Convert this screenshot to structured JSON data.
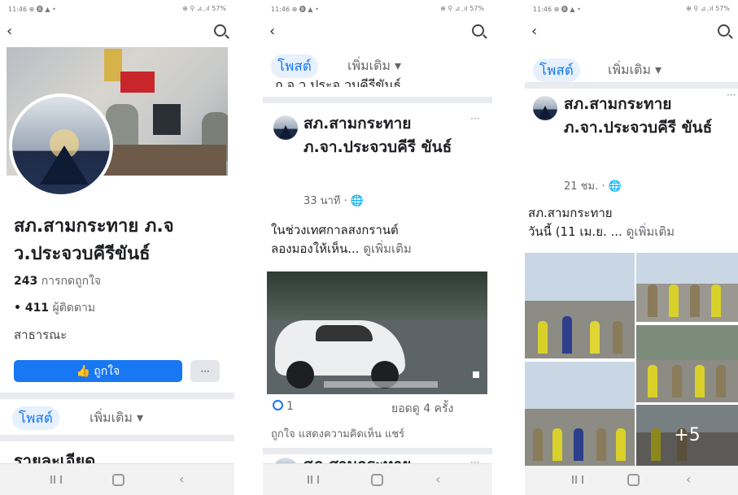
{
  "status_bar": {
    "time": "11:46 ⊕ 🅑 ▲ •",
    "right": "⊕ ⚲ ⊿ ᷊.ıl 57%"
  },
  "colors": {
    "accent": "#1877f2",
    "text": "#1c1e21",
    "muted": "#65676b"
  },
  "icons": {
    "back": "back-arrow-icon",
    "search": "search-icon"
  },
  "panel1": {
    "page_name": "สภ.สามกระทาย ภ.จ ว.ประจวบคีรีขันธ์",
    "likes_count": "243",
    "likes_label": "การกดถูกใจ",
    "followers_count": "411",
    "followers_label": "ผู้ติดตาม",
    "category": "สาธารณะ",
    "like_button": "ถูกใจ",
    "more_button": "···",
    "tab_posts": "โพสต์",
    "tab_more": "เพิ่มเติม ▾",
    "section_title": "รายละเอียด"
  },
  "panel2": {
    "tab_posts": "โพสต์",
    "tab_more": "เพิ่มเติม ▾",
    "cut_text": "ภ.จ ว.ประจ วบคีรีขันธ์",
    "post": {
      "author": "สภ.สามกระทาย ภ.จา.ประจวบคีรี ขันธ์",
      "time": "33 นาที · 🌐",
      "text_line1": "ในช่วงเทศกาลสงกรานต์",
      "text_line2": "ลองมองให้เห็น...",
      "see_more": "ดูเพิ่มเติม",
      "reactions": "1",
      "views": "ยอดดู 4 ครั้ง",
      "actions": "ถูกใจ  แสดงความคิดเห็น  แชร์",
      "next_author": "สภ.สามกระทาย"
    }
  },
  "panel3": {
    "tab_posts": "โพสต์",
    "tab_more": "เพิ่มเติม ▾",
    "post": {
      "author": "สภ.สามกระทาย ภ.จา.ประจวบคีรี ขันธ์",
      "time": "21 ชม. · 🌐",
      "text_line1": "สภ.สามกระทาย",
      "text_line2": "วันนี้ (11 เม.ย. ...",
      "see_more": "ดูเพิ่มเติม",
      "more_photos": "+5"
    }
  },
  "navbar": {
    "recents": "recents-icon",
    "home": "home-icon",
    "back": "‹"
  }
}
